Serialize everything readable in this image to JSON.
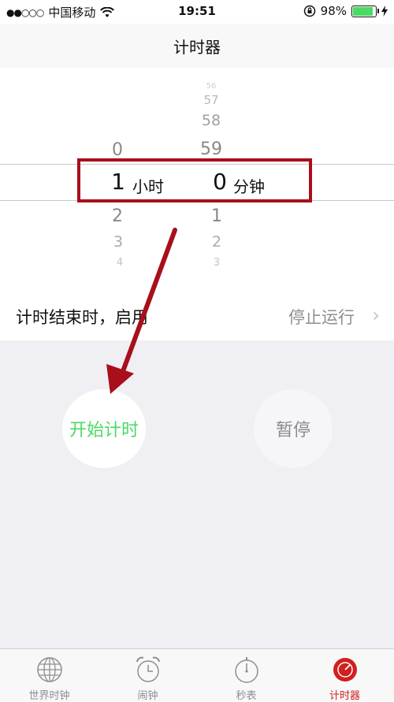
{
  "status_bar": {
    "signal_dots": "●●○○○",
    "carrier": "中国移动",
    "time": "19:51",
    "battery_percent": "98%",
    "battery_level": 0.98
  },
  "nav": {
    "title": "计时器"
  },
  "picker": {
    "hours": {
      "above": [
        "0"
      ],
      "selected": "1",
      "below": [
        "2",
        "3",
        "4"
      ]
    },
    "minutes": {
      "above": [
        "56",
        "57",
        "58",
        "59"
      ],
      "selected": "0",
      "below": [
        "1",
        "2",
        "3"
      ]
    },
    "hour_unit": "小时",
    "minute_unit": "分钟"
  },
  "when_done": {
    "label": "计时结束时，启用",
    "value": "停止运行"
  },
  "buttons": {
    "start": "开始计时",
    "pause": "暂停"
  },
  "tabs": [
    {
      "label": "世界时钟",
      "icon": "globe-icon",
      "active": false
    },
    {
      "label": "闹钟",
      "icon": "alarm-clock-icon",
      "active": false
    },
    {
      "label": "秒表",
      "icon": "stopwatch-icon",
      "active": false
    },
    {
      "label": "计时器",
      "icon": "timer-icon",
      "active": true
    }
  ],
  "colors": {
    "accent_green": "#4cd964",
    "tab_active_red": "#d0201f",
    "annotation_red": "#a80f1b"
  }
}
